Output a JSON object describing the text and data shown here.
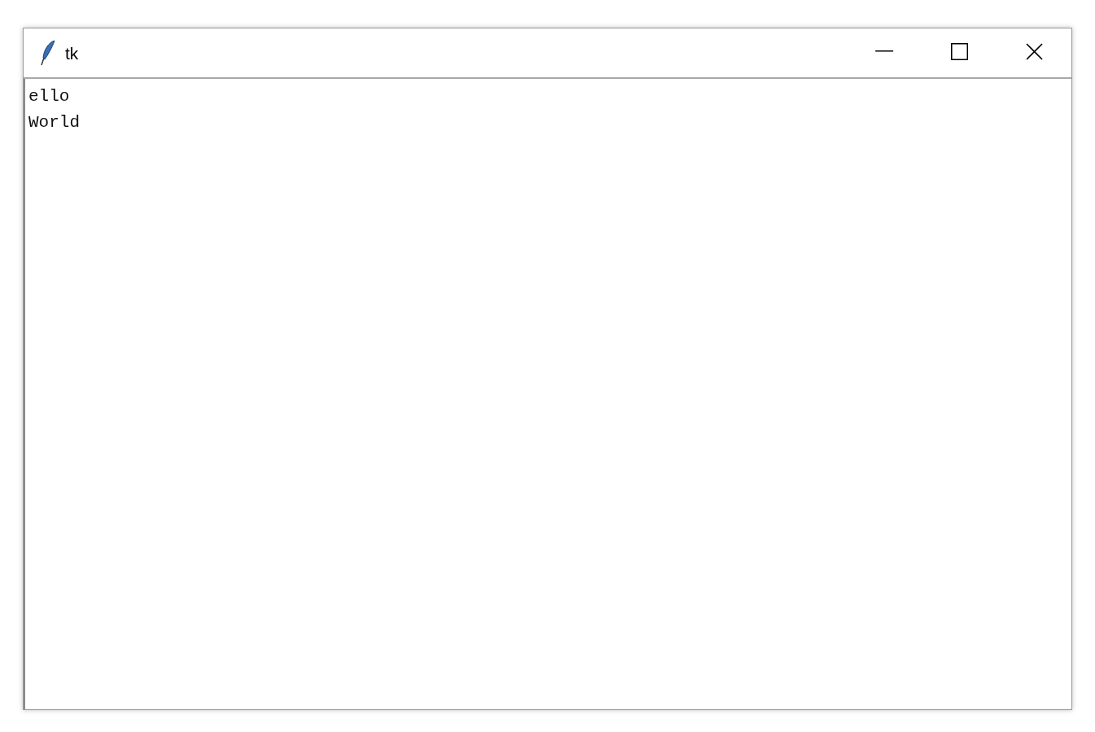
{
  "window": {
    "title": "tk"
  },
  "text_area": {
    "lines": [
      "ello",
      "World"
    ]
  }
}
